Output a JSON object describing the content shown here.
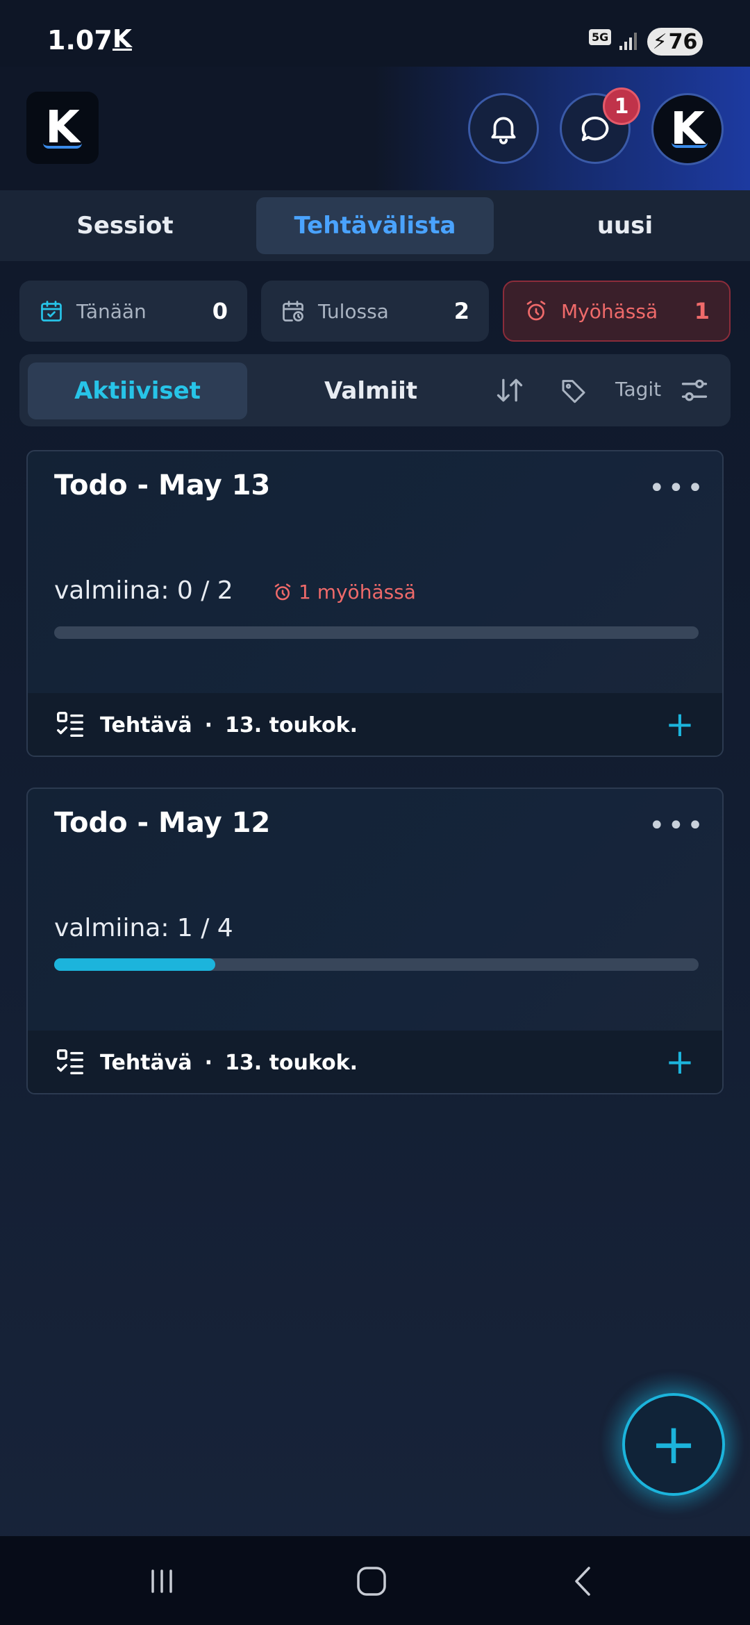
{
  "status_bar": {
    "time": "1.07",
    "carrier_icon_label": "K",
    "network": "5G",
    "battery": "76"
  },
  "header": {
    "logo_letter": "K",
    "notification_badge": "1",
    "avatar_letter": "K"
  },
  "main_tabs": [
    {
      "label": "Sessiot",
      "active": false
    },
    {
      "label": "Tehtävälista",
      "active": true
    },
    {
      "label": "uusi",
      "active": false
    }
  ],
  "stats": {
    "today": {
      "label": "Tänään",
      "count": "0",
      "icon": "calendar-check-icon"
    },
    "upcoming": {
      "label": "Tulossa",
      "count": "2",
      "icon": "calendar-clock-icon"
    },
    "late": {
      "label": "Myöhässä",
      "count": "1",
      "icon": "alarm-icon"
    }
  },
  "filters": {
    "active_tab": "Aktiiviset",
    "done_tab": "Valmiit",
    "tags_label": "Tagit"
  },
  "cards": [
    {
      "title": "Todo - May 13",
      "progress_text": "valmiina: 0 / 2",
      "late_text": "1 myöhässä",
      "progress_fraction": 0.0,
      "footer_type": "Tehtävä",
      "footer_date": "13. toukok."
    },
    {
      "title": "Todo - May 12",
      "progress_text": "valmiina: 1 / 4",
      "late_text": "",
      "progress_fraction": 0.25,
      "footer_type": "Tehtävä",
      "footer_date": "13. toukok."
    }
  ],
  "colors": {
    "accent_cyan": "#1cb4dc",
    "accent_blue": "#4aa3ff",
    "late_red": "#ef6a6a",
    "background": "#111a2c"
  }
}
